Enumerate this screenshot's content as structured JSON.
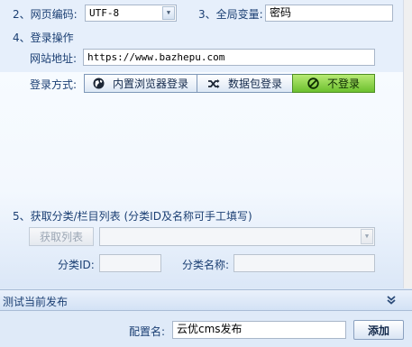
{
  "section2": {
    "encoding_label": "2、网页编码:",
    "encoding_value": "UTF-8",
    "global_var_label": "3、全局变量:",
    "global_var_value": "密码"
  },
  "section4": {
    "title": "4、登录操作",
    "url_label": "网站地址:",
    "url_value": "https://www.bazhepu.com",
    "login_method_label": "登录方式:",
    "login_options": [
      {
        "label": "内置浏览器登录",
        "icon": "globe-icon"
      },
      {
        "label": "数据包登录",
        "icon": "shuffle-icon"
      },
      {
        "label": "不登录",
        "icon": "no-entry-icon"
      }
    ],
    "selected_option": "不登录"
  },
  "section5": {
    "title": "5、获取分类/栏目列表 (分类ID及名称可手工填写)",
    "fetch_button": "获取列表",
    "category_select_value": "",
    "category_id_label": "分类ID:",
    "category_id_value": "",
    "category_name_label": "分类名称:",
    "category_name_value": ""
  },
  "test_bar": {
    "label": "测试当前发布",
    "icon": "double-chevron-down-icon"
  },
  "footer": {
    "config_name_label": "配置名:",
    "config_name_value": "云优cms发布",
    "add_button": "添加"
  },
  "colors": {
    "label_text": "#1b3f73",
    "active_green": "#6cc02e",
    "panel_bg": "#e6effb"
  }
}
